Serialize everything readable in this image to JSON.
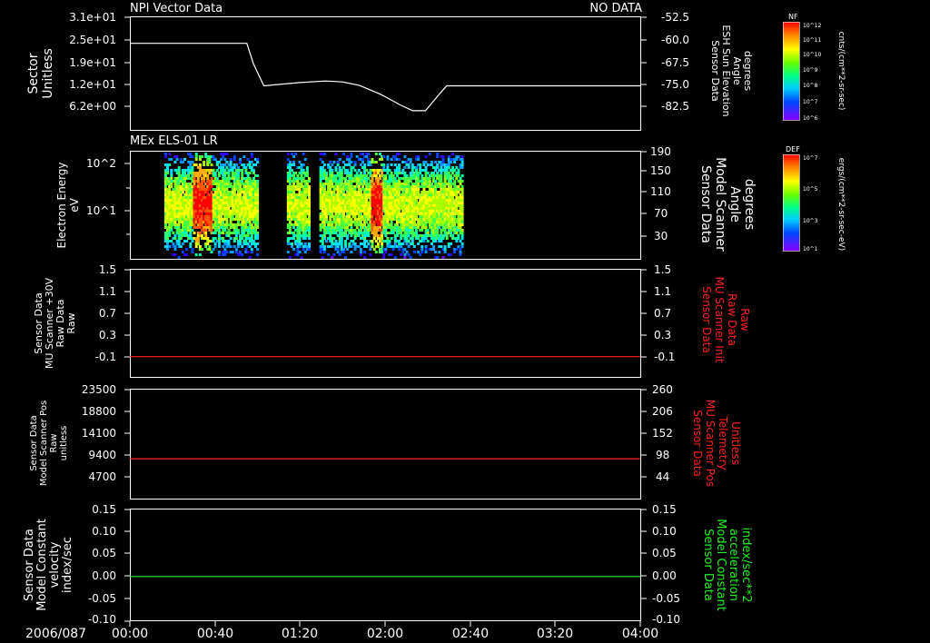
{
  "colors": {
    "background": "#000000",
    "axis": "#ffffff",
    "red": "#ff2020",
    "green": "#22ee22"
  },
  "x_axis": {
    "date_label": "2006/087",
    "ticks": [
      "00:00",
      "00:40",
      "01:20",
      "02:00",
      "02:40",
      "03:20",
      "04:00"
    ]
  },
  "chart_data": [
    {
      "type": "line",
      "title_left": "NPI Vector Data",
      "title_right": "NO DATA",
      "left_ylabel": [
        "Sector",
        "Unitless"
      ],
      "left_ticks": [
        "3.1e+01",
        "2.5e+01",
        "1.9e+01",
        "1.2e+01",
        "6.2e+00"
      ],
      "right_ylabel": [
        "Sensor Data",
        "ESH Sun Elevation",
        "Angle",
        "degrees"
      ],
      "right_ticks": [
        "-52.5",
        "-60.0",
        "-67.5",
        "-75.0",
        "-82.5"
      ],
      "right_ylim": [
        -52.5,
        -90
      ],
      "series": [
        {
          "x_minutes": [
            0,
            55,
            58,
            63,
            80,
            92,
            100,
            108,
            118,
            127,
            133,
            139,
            146,
            149,
            154,
            240
          ],
          "y_degrees": [
            -61.3,
            -61.3,
            -68.0,
            -75.6,
            -74.5,
            -74.0,
            -74.3,
            -75.5,
            -78.5,
            -82.0,
            -84.0,
            -84.0,
            -78.0,
            -75.6,
            -75.6,
            -75.6
          ]
        }
      ],
      "colorbar": {
        "label": "NF",
        "top": "10^12",
        "bottom": "10^6",
        "ticks": [
          "10^11",
          "10^10",
          "10^9",
          "10^8",
          "10^7"
        ],
        "units": "cnts/(cm**2-sr-sec)"
      }
    },
    {
      "type": "heatmap",
      "title_left": "MEx ELS-01 LR",
      "left_ylabel": [
        "Electron Energy",
        "eV"
      ],
      "left_ticks": [
        "10^2",
        "10^1"
      ],
      "right_ylabel": [
        "Sensor Data",
        "Model Scanner",
        "Angle",
        "degrees"
      ],
      "right_ticks": [
        "190",
        "150",
        "110",
        "70",
        "30"
      ],
      "data_extent_minutes": [
        [
          16,
          60
        ],
        [
          73,
          84
        ],
        [
          89,
          156
        ]
      ],
      "gap_minutes": [
        60,
        73
      ],
      "intense_bands_minutes": [
        [
          29,
          38
        ],
        [
          113,
          118
        ]
      ],
      "colorbar": {
        "label": "DEF",
        "top": "10^7",
        "bottom": "10^1",
        "ticks": [
          "10^5",
          "10^3"
        ],
        "units": "ergs/(cm**2-sr-sec-eV)"
      }
    },
    {
      "type": "line",
      "left_ylabel": [
        "Sensor Data",
        "MU Scanner +30V",
        "Raw Data",
        "Raw"
      ],
      "left_ticks": [
        "1.5",
        "1.1",
        "0.7",
        "0.3",
        "-0.1"
      ],
      "right_ylabel": [
        "Sensor Data",
        "MU Scanner Init",
        "Raw Data",
        "Raw"
      ],
      "right_ticks": [
        "1.5",
        "1.1",
        "0.7",
        "0.3",
        "-0.1"
      ],
      "ylim": [
        -0.35,
        1.5
      ],
      "series": [
        {
          "color": "red",
          "x_minutes": [
            0,
            240
          ],
          "y": [
            0.0,
            0.0
          ]
        }
      ]
    },
    {
      "type": "line",
      "left_ylabel": [
        "Sensor Data",
        "Model Scanner Pos",
        "Raw",
        "unitless"
      ],
      "left_ticks": [
        "23500",
        "18800",
        "14100",
        "9400",
        "4700"
      ],
      "right_ylabel": [
        "Sensor Data",
        "MU Scanner Pos",
        "Telemetry",
        "Unitless"
      ],
      "right_ticks": [
        "260",
        "206",
        "152",
        "98",
        "44"
      ],
      "ylim": [
        0,
        23500
      ],
      "series": [
        {
          "color": "red",
          "x_minutes": [
            0,
            240
          ],
          "y": [
            8600,
            8600
          ]
        }
      ]
    },
    {
      "type": "line",
      "left_ylabel": [
        "Sensor Data",
        "Model Constant",
        "velocity",
        "index/sec"
      ],
      "left_ticks": [
        "0.15",
        "0.10",
        "0.05",
        "0.00",
        "-0.05",
        "-0.10"
      ],
      "right_ylabel": [
        "Sensor Data",
        "Model Constant",
        "acceleration",
        "index/sec**2"
      ],
      "right_ticks": [
        "0.15",
        "0.10",
        "0.05",
        "0.00",
        "-0.05",
        "-0.10"
      ],
      "ylim": [
        -0.1,
        0.15
      ],
      "series": [
        {
          "color": "green",
          "x_minutes": [
            0,
            240
          ],
          "y": [
            0.0,
            0.0
          ]
        }
      ]
    }
  ]
}
